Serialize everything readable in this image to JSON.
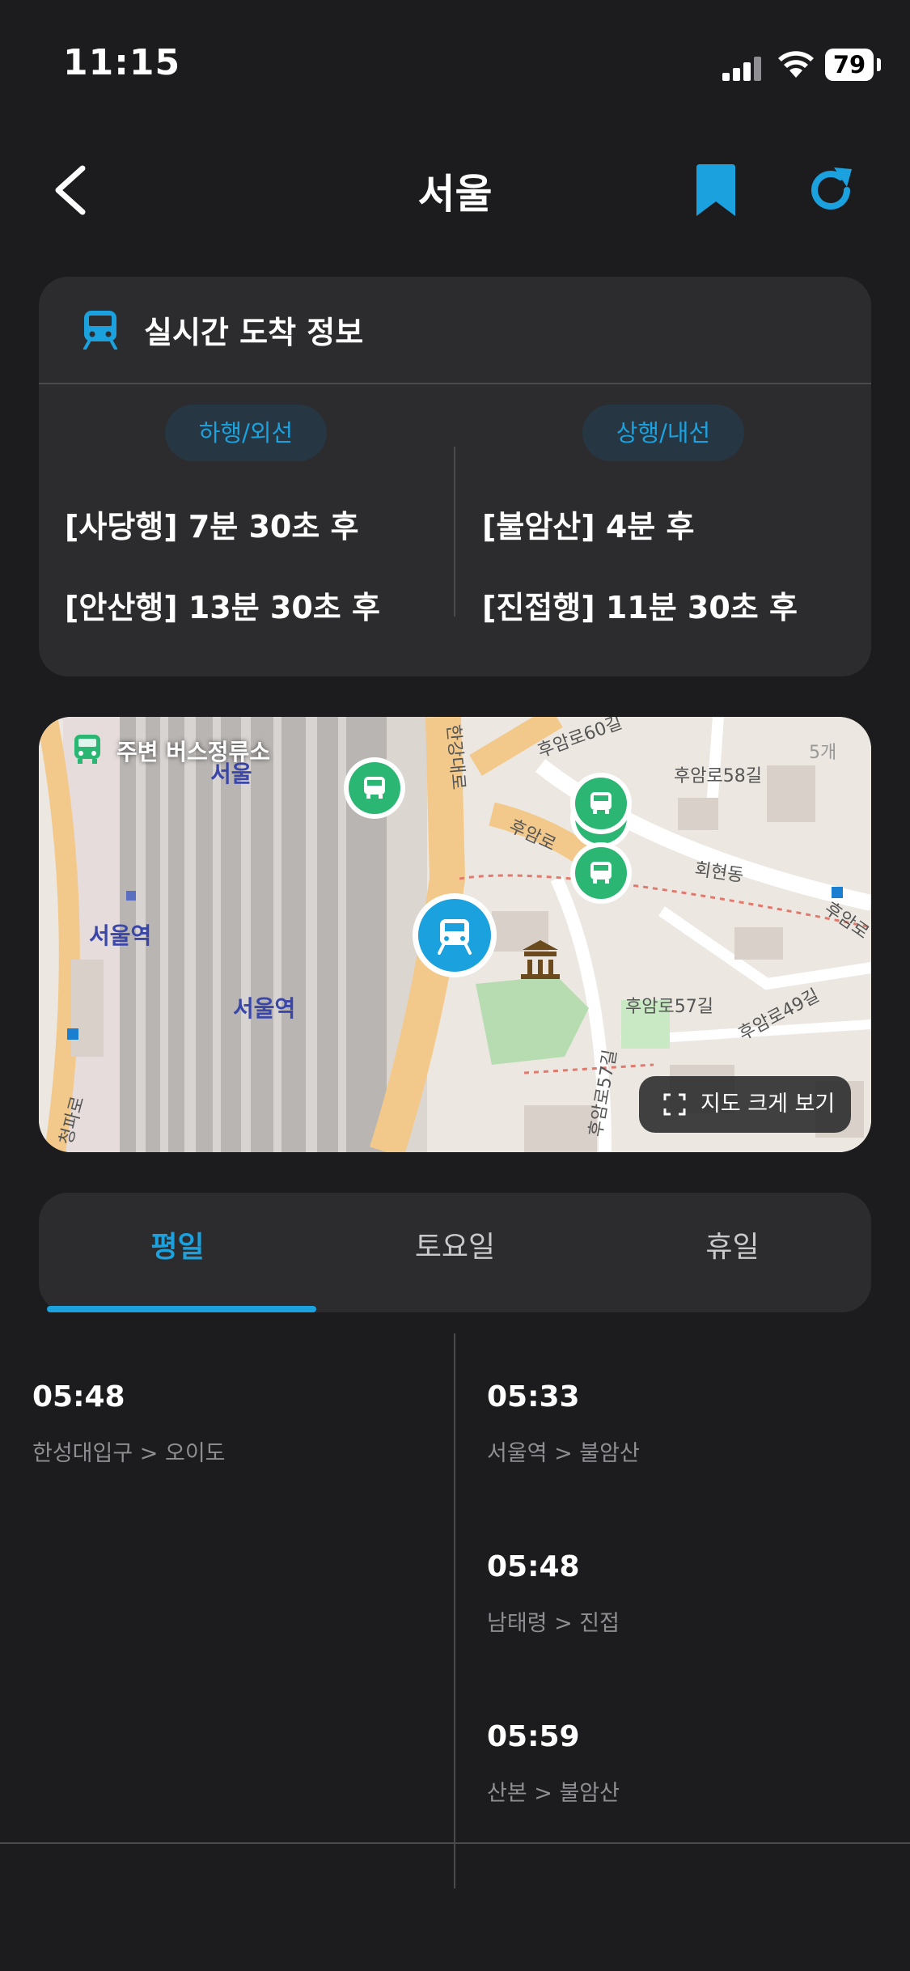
{
  "status_bar": {
    "time": "11:15",
    "battery": "79"
  },
  "header": {
    "title": "서울"
  },
  "realtime": {
    "title": "실시간 도착 정보",
    "down": {
      "label": "하행/외선",
      "arrivals": [
        "[사당행] 7분 30초 후",
        "[안산행] 13분 30초 후"
      ]
    },
    "up": {
      "label": "상행/내선",
      "arrivals": [
        "[불암산] 4분 후",
        "[진접행] 11분 30초 후"
      ]
    }
  },
  "map": {
    "label": "주변 버스정류소",
    "count": "5개",
    "expand_label": "지도 크게 보기",
    "place_labels": [
      "서울역",
      "서울역",
      "서울",
      "후암로60길",
      "후암로58길",
      "회현동",
      "후암로57길",
      "후암로49길",
      "후암로57길",
      "청파로",
      "후암로",
      "한강대로",
      "후암로"
    ]
  },
  "tabs": [
    "평일",
    "토요일",
    "휴일"
  ],
  "timetable": {
    "left": [
      {
        "time": "05:48",
        "route": "한성대입구 > 오이도"
      }
    ],
    "right": [
      {
        "time": "05:33",
        "route": "서울역 > 불암산"
      },
      {
        "time": "05:48",
        "route": "남태령 > 진접"
      },
      {
        "time": "05:59",
        "route": "산본 > 불암산"
      }
    ]
  },
  "colors": {
    "accent": "#1aa1de",
    "bus_green": "#2bb673",
    "background": "#1c1c1e",
    "card": "#2c2c2e"
  }
}
